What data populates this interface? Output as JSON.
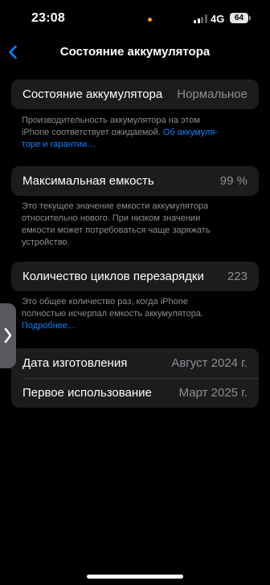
{
  "status_bar": {
    "time": "23:08",
    "network": "4G",
    "battery_level": "64",
    "signal_bars_active": 2,
    "signal_bars_total": 4
  },
  "nav": {
    "title": "Состояние аккумулятора",
    "back_icon": "chevron-left-icon"
  },
  "health": {
    "label": "Состояние аккумулятора",
    "value": "Нормальное",
    "note_line1": "Производительность аккумулятора на этом",
    "note_line2_text": "iPhone соответствует ожидаемой.",
    "note_link_part1": "Об аккумуля-",
    "note_link_part2": "торе и гарантии…"
  },
  "capacity": {
    "label": "Максимальная емкость",
    "value": "99 %",
    "note_line1": "Это текущее значение емкости аккумулятора",
    "note_line2": "относительно нового. При низком значении",
    "note_line3": "емкости может потребоваться чаще заряжать",
    "note_line4": "устройство."
  },
  "cycles": {
    "label": "Количество циклов перезарядки",
    "value": "223",
    "note_line1": "Это общее количество раз, когда iPhone",
    "note_line2": "полностью исчерпал емкость аккумулятора.",
    "note_link": "Подробнее…"
  },
  "dates": {
    "manufacture_label": "Дата изготовления",
    "manufacture_value": "Август 2024 г.",
    "first_use_label": "Первое использование",
    "first_use_value": "Март 2025 г."
  },
  "side_handle": {
    "icon": "chevron-right-icon"
  },
  "colors": {
    "background": "#000000",
    "group_background": "#1c1c1e",
    "secondary_text": "#8e8e93",
    "link": "#0a84ff",
    "indicator_dot": "#ff9f0a"
  }
}
